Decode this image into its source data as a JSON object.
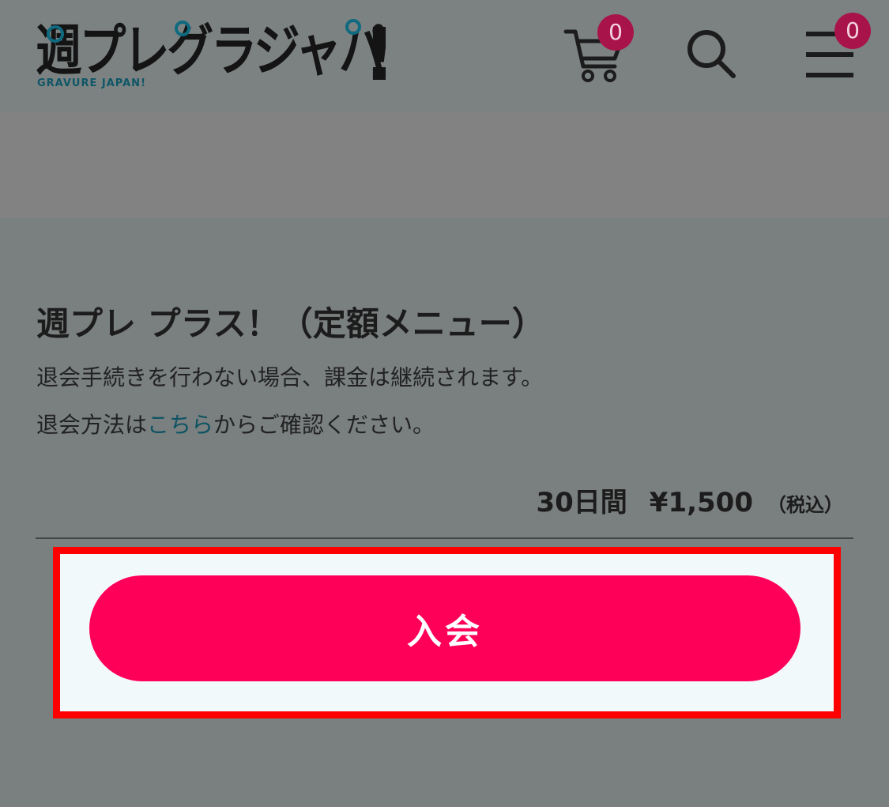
{
  "header": {
    "logo_text": "週プレグラジャパ",
    "logo_exclamation": "!",
    "logo_subtitle": "GRAVURE JAPAN!",
    "cart_count": "0",
    "menu_count": "0",
    "icons": [
      "cart-icon",
      "search-icon",
      "hamburger-menu-icon"
    ],
    "badge_color": "#a8134a"
  },
  "plan": {
    "title": "週プレ プラス！（定額メニュー）",
    "notice_line1": "退会手続きを行わない場合、課金は継続されます。",
    "notice_line2_before": "退会方法は",
    "notice_line2_link": "こちら",
    "notice_line2_after": "からご確認ください。",
    "price_period": "30日間",
    "price_amount": "¥1,500",
    "price_tax": "（税込）"
  },
  "actions": {
    "join_label": "入会",
    "join_color": "#ff0059",
    "highlight_color": "#ff0000"
  }
}
